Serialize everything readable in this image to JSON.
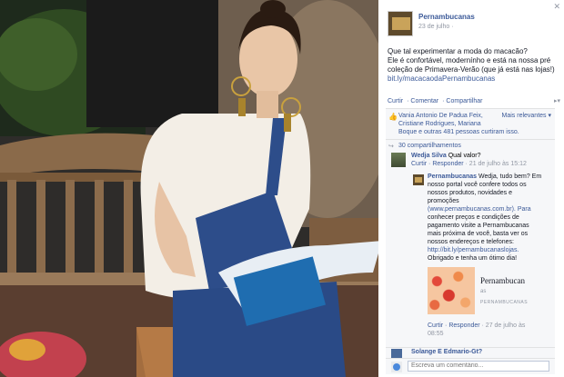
{
  "post": {
    "page_name": "Pernambucanas",
    "time": "23 de julho · ",
    "close_glyph": "✕",
    "lines": [
      "Que tal experimentar a moda do macacão?",
      "Ele é confortável, modernínho e está na nossa pré",
      "coleção de Primavera-Verão (que já está nas lojas!)"
    ],
    "link": "bit.ly/macacaodaPernambucanas",
    "actions": [
      "Curtir",
      "Comentar",
      "Compartilhar"
    ]
  },
  "likes": {
    "line1": "Vania Antonio De Padua Feix, ",
    "line2": "Cristiane Rodrigues, Mariana",
    "line3": "Boque e outras 481 pessoas curtiram isso.",
    "more": "Mais relevantes ▾",
    "shares": "30 compartilhamentos"
  },
  "comments": {
    "c1_name": "Wedja Silva",
    "c1_text": " Qual valor?",
    "c1_action": "Curtir · Responder",
    "c1_time": " · 21 de julho às 15:12",
    "reply_name": "Pernambucanas",
    "reply_lines": [
      " Wedja, tudo bem? Em",
      "nosso portal você confere todos os",
      "nossos produtos, novidades e",
      "promoções",
      "(www.pernambucanas.com.br). Para",
      "conhecer preços e condições de",
      "pagamento visite a Pernambucanas",
      "mais próxima de você, basta ver os",
      "nossos endereços e telefones:",
      "http://bit.ly/pernambucanaslojas.",
      "Obrigado e tenha um ótimo dia!"
    ],
    "preview_title": "Pernambucan",
    "preview_sub": "as",
    "preview_brand": "PERNAMBUCANAS",
    "reply_action": "Curtir · Responder",
    "reply_time": " · 27 de julho às",
    "reply_time2": "08:55",
    "c3_name": "Solange E Edmario-Gt?"
  },
  "write": {
    "placeholder": "Escreva um comentário..."
  },
  "colors": {
    "link": "#3b5998",
    "meta": "#9197a3",
    "comment_bg": "#f6f7f9"
  }
}
